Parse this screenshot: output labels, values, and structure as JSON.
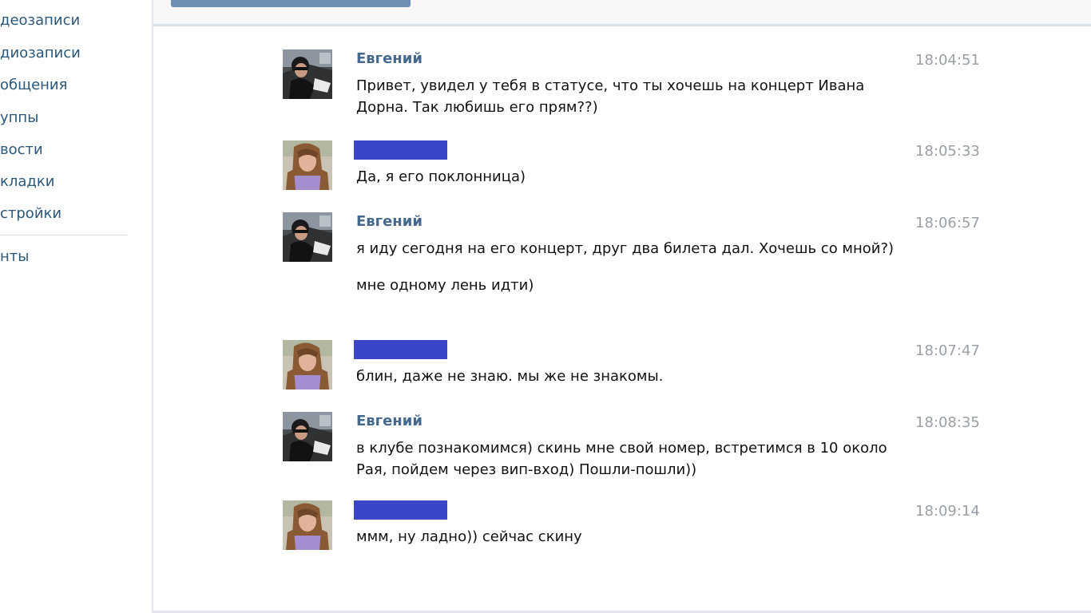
{
  "sidebar": {
    "items": [
      {
        "label": "деозаписи"
      },
      {
        "label": "диозаписи"
      },
      {
        "label": "общения"
      },
      {
        "label": "уппы"
      },
      {
        "label": "вости"
      },
      {
        "label": "кладки"
      },
      {
        "label": "стройки"
      },
      {
        "label": "нты"
      }
    ]
  },
  "messages": [
    {
      "author": "Евгений",
      "time": "18:04:51",
      "paragraphs": [
        "Привет, увидел у тебя в статусе, что ты хочешь на концерт Ивана Дорна. Так любишь его прям??)"
      ]
    },
    {
      "author": "",
      "time": "18:05:33",
      "paragraphs": [
        "Да, я его поклонница)"
      ]
    },
    {
      "author": "Евгений",
      "time": "18:06:57",
      "paragraphs": [
        "я иду сегодня на его концерт, друг два билета дал. Хочешь со мной?)",
        "мне одному лень идти)"
      ]
    },
    {
      "author": "",
      "time": "18:07:47",
      "paragraphs": [
        "блин, даже не знаю. мы же не знакомы."
      ]
    },
    {
      "author": "Евгений",
      "time": "18:08:35",
      "paragraphs": [
        "в клубе познакомимся) скинь мне свой номер, встретимся в 10 около Рая, пойдем через вип-вход) Пошли-пошли))"
      ]
    },
    {
      "author": "",
      "time": "18:09:14",
      "paragraphs": [
        "ммм, ну ладно)) сейчас скину"
      ]
    }
  ],
  "colors": {
    "link": "#2b587a",
    "author": "#45688e",
    "mask": "#3b45c8",
    "time": "#9aa0a6"
  }
}
